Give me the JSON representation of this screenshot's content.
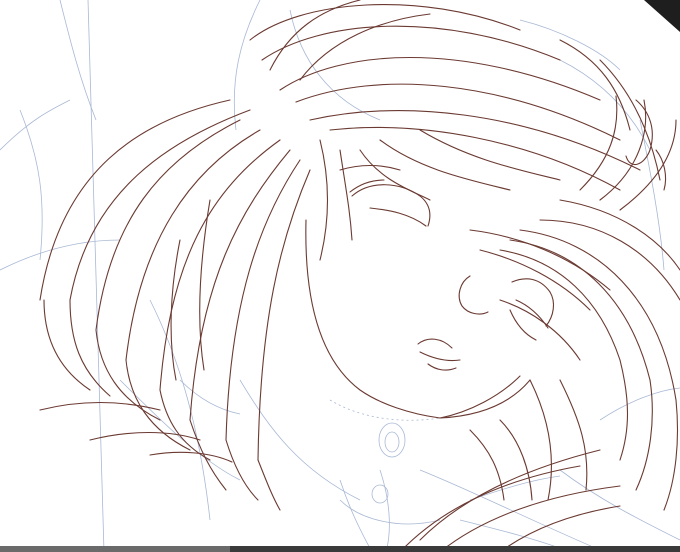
{
  "canvas": {
    "background": "#ffffff",
    "ink_colors": {
      "line_art": "#6b3a32",
      "construction_sketch": "#8fa3c8"
    }
  },
  "scrollbar": {
    "color": "#3a3a3a"
  }
}
